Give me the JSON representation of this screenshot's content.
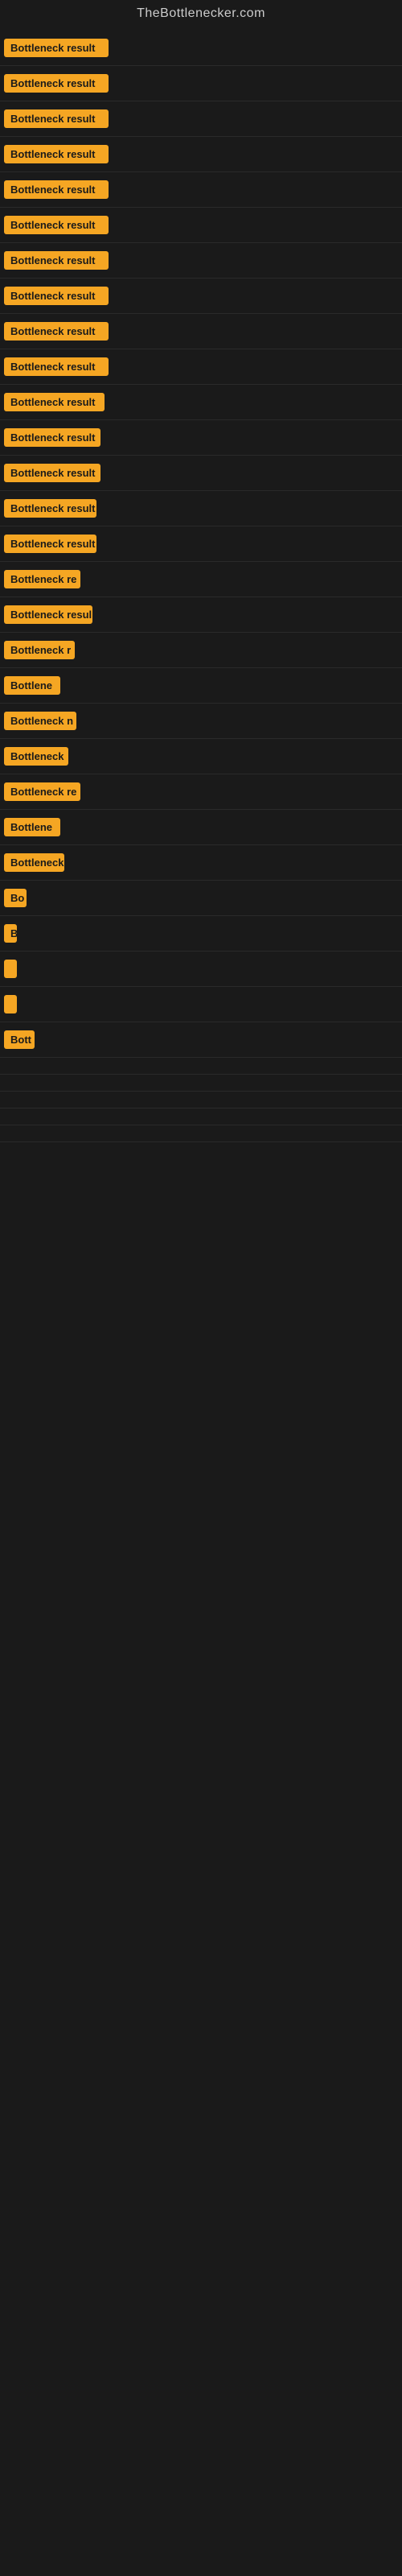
{
  "site": {
    "title": "TheBottlenecker.com"
  },
  "items": [
    {
      "id": 1,
      "label": "Bottleneck result",
      "badge_width": 130
    },
    {
      "id": 2,
      "label": "Bottleneck result",
      "badge_width": 130
    },
    {
      "id": 3,
      "label": "Bottleneck result",
      "badge_width": 130
    },
    {
      "id": 4,
      "label": "Bottleneck result",
      "badge_width": 130
    },
    {
      "id": 5,
      "label": "Bottleneck result",
      "badge_width": 130
    },
    {
      "id": 6,
      "label": "Bottleneck result",
      "badge_width": 130
    },
    {
      "id": 7,
      "label": "Bottleneck result",
      "badge_width": 130
    },
    {
      "id": 8,
      "label": "Bottleneck result",
      "badge_width": 130
    },
    {
      "id": 9,
      "label": "Bottleneck result",
      "badge_width": 130
    },
    {
      "id": 10,
      "label": "Bottleneck result",
      "badge_width": 130
    },
    {
      "id": 11,
      "label": "Bottleneck result",
      "badge_width": 125
    },
    {
      "id": 12,
      "label": "Bottleneck result",
      "badge_width": 120
    },
    {
      "id": 13,
      "label": "Bottleneck result",
      "badge_width": 120
    },
    {
      "id": 14,
      "label": "Bottleneck result",
      "badge_width": 115
    },
    {
      "id": 15,
      "label": "Bottleneck result",
      "badge_width": 115
    },
    {
      "id": 16,
      "label": "Bottleneck re",
      "badge_width": 95
    },
    {
      "id": 17,
      "label": "Bottleneck resul",
      "badge_width": 110
    },
    {
      "id": 18,
      "label": "Bottleneck r",
      "badge_width": 88
    },
    {
      "id": 19,
      "label": "Bottlene",
      "badge_width": 70
    },
    {
      "id": 20,
      "label": "Bottleneck n",
      "badge_width": 90
    },
    {
      "id": 21,
      "label": "Bottleneck",
      "badge_width": 80
    },
    {
      "id": 22,
      "label": "Bottleneck re",
      "badge_width": 95
    },
    {
      "id": 23,
      "label": "Bottlene",
      "badge_width": 70
    },
    {
      "id": 24,
      "label": "Bottleneck",
      "badge_width": 75
    },
    {
      "id": 25,
      "label": "Bo",
      "badge_width": 28
    },
    {
      "id": 26,
      "label": "B",
      "badge_width": 16
    },
    {
      "id": 27,
      "label": "",
      "badge_width": 8
    },
    {
      "id": 28,
      "label": "",
      "badge_width": 6
    },
    {
      "id": 29,
      "label": "Bott",
      "badge_width": 38
    },
    {
      "id": 30,
      "label": "",
      "badge_width": 0
    },
    {
      "id": 31,
      "label": "",
      "badge_width": 0
    },
    {
      "id": 32,
      "label": "",
      "badge_width": 0
    },
    {
      "id": 33,
      "label": "",
      "badge_width": 0
    },
    {
      "id": 34,
      "label": "",
      "badge_width": 0
    }
  ]
}
